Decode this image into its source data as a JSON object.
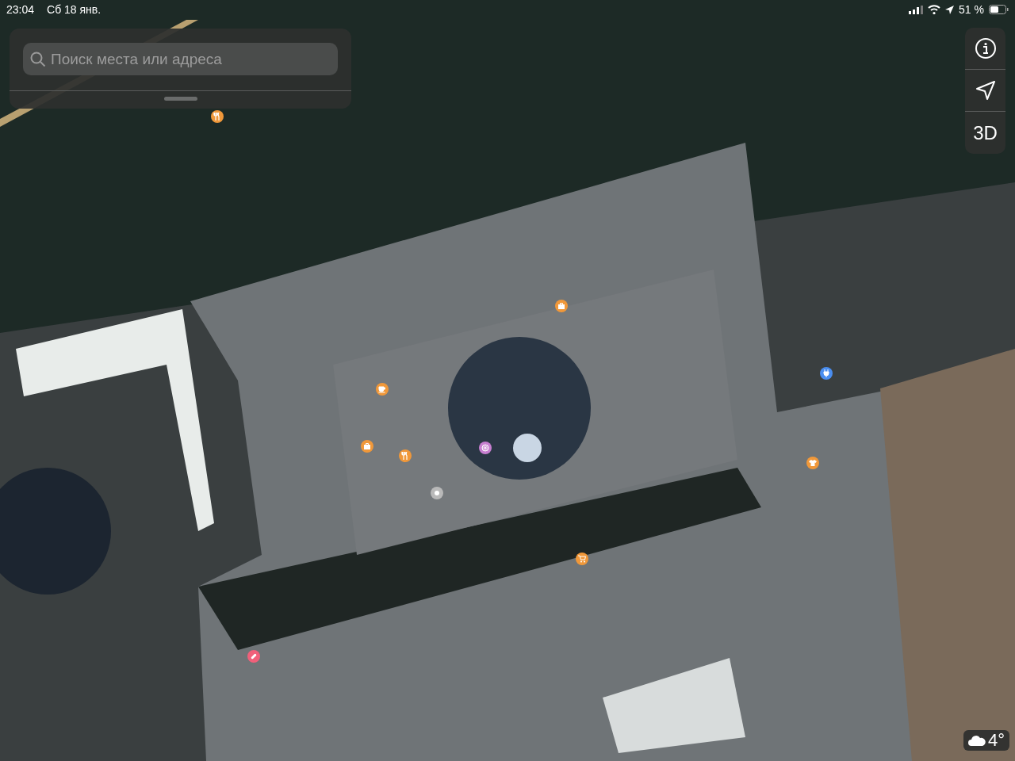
{
  "status_bar": {
    "time": "23:04",
    "date": "Сб 18 янв.",
    "battery": "51 %"
  },
  "search": {
    "placeholder": "Поиск места или адреса"
  },
  "map_controls": [
    {
      "kind": "info"
    },
    {
      "kind": "locate"
    },
    {
      "kind": "text",
      "label": "3D"
    }
  ],
  "pins": [
    {
      "kind": "restaurant",
      "color": "#f0983a"
    },
    {
      "kind": "store",
      "color": "#f0983a"
    },
    {
      "kind": "cafe",
      "color": "#f0983a"
    },
    {
      "kind": "briefcase",
      "color": "#f0983a"
    },
    {
      "kind": "restaurant",
      "color": "#f0983a"
    },
    {
      "kind": "wheel",
      "color": "#c77fd0"
    },
    {
      "kind": "dot",
      "color": "#b9b9b9"
    },
    {
      "kind": "cart",
      "color": "#f0983a"
    },
    {
      "kind": "plug",
      "color": "#4a8ef0"
    },
    {
      "kind": "shirt",
      "color": "#f0983a"
    },
    {
      "kind": "pharmacy",
      "color": "#f0607a"
    }
  ],
  "weather": {
    "temperature": "4°"
  }
}
